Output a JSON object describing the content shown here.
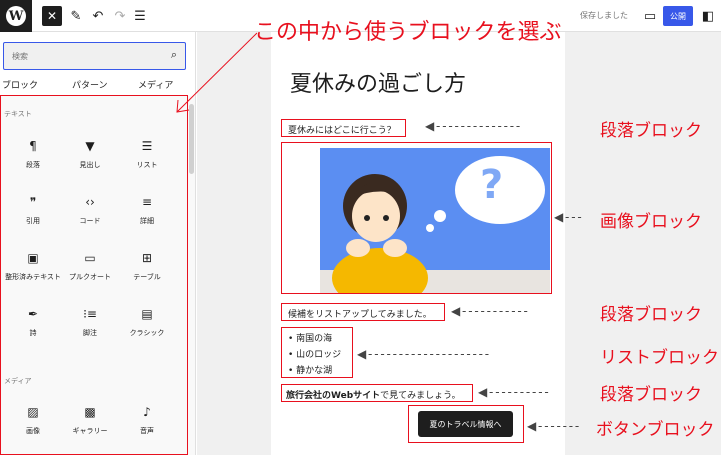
{
  "topbar": {
    "logo": "W",
    "close_icon": "✕",
    "tool_icon": "✎",
    "undo_icon": "↶",
    "redo_icon": "↷",
    "list_icon": "☰",
    "saved_text": "保存しました",
    "view_icon": "▭",
    "publish_label": "公開",
    "settings_icon": "◧"
  },
  "sidebar": {
    "search_placeholder": "検索",
    "search_icon": "⌕",
    "tabs": [
      "ブロック",
      "パターン",
      "メディア"
    ],
    "section_text": "テキスト",
    "section_media": "メディア",
    "blocks_text": [
      {
        "icon": "¶",
        "label": "段落"
      },
      {
        "icon": "▼",
        "label": "見出し"
      },
      {
        "icon": "☰",
        "label": "リスト"
      },
      {
        "icon": "❞",
        "label": "引用"
      },
      {
        "icon": "‹›",
        "label": "コード"
      },
      {
        "icon": "≡",
        "label": "詳細"
      },
      {
        "icon": "▣",
        "label": "整形済みテキスト"
      },
      {
        "icon": "▭",
        "label": "プルクオート"
      },
      {
        "icon": "⊞",
        "label": "テーブル"
      },
      {
        "icon": "✒",
        "label": "詩"
      },
      {
        "icon": "⁝≡",
        "label": "脚注"
      },
      {
        "icon": "▤",
        "label": "クラシック"
      }
    ],
    "blocks_media": [
      {
        "icon": "▨",
        "label": "画像"
      },
      {
        "icon": "▩",
        "label": "ギャラリー"
      },
      {
        "icon": "♪",
        "label": "音声"
      }
    ]
  },
  "post": {
    "title": "夏休みの過ごし方",
    "para1": "夏休みにはどこに行こう？",
    "para2": "候補をリストアップしてみました。",
    "list": [
      "南国の海",
      "山のロッジ",
      "静かな湖"
    ],
    "para3_bold": "旅行会社のWebサイト",
    "para3_rest": "で見てみましょう。",
    "button_label": "夏のトラベル情報へ",
    "image_qmark": "?"
  },
  "annotations": {
    "top": "この中から使うブロックを選ぶ",
    "para1": "段落ブロック",
    "image": "画像ブロック",
    "para2": "段落ブロック",
    "list": "リストブロック",
    "para3": "段落ブロック",
    "button": "ボタンブロック"
  }
}
